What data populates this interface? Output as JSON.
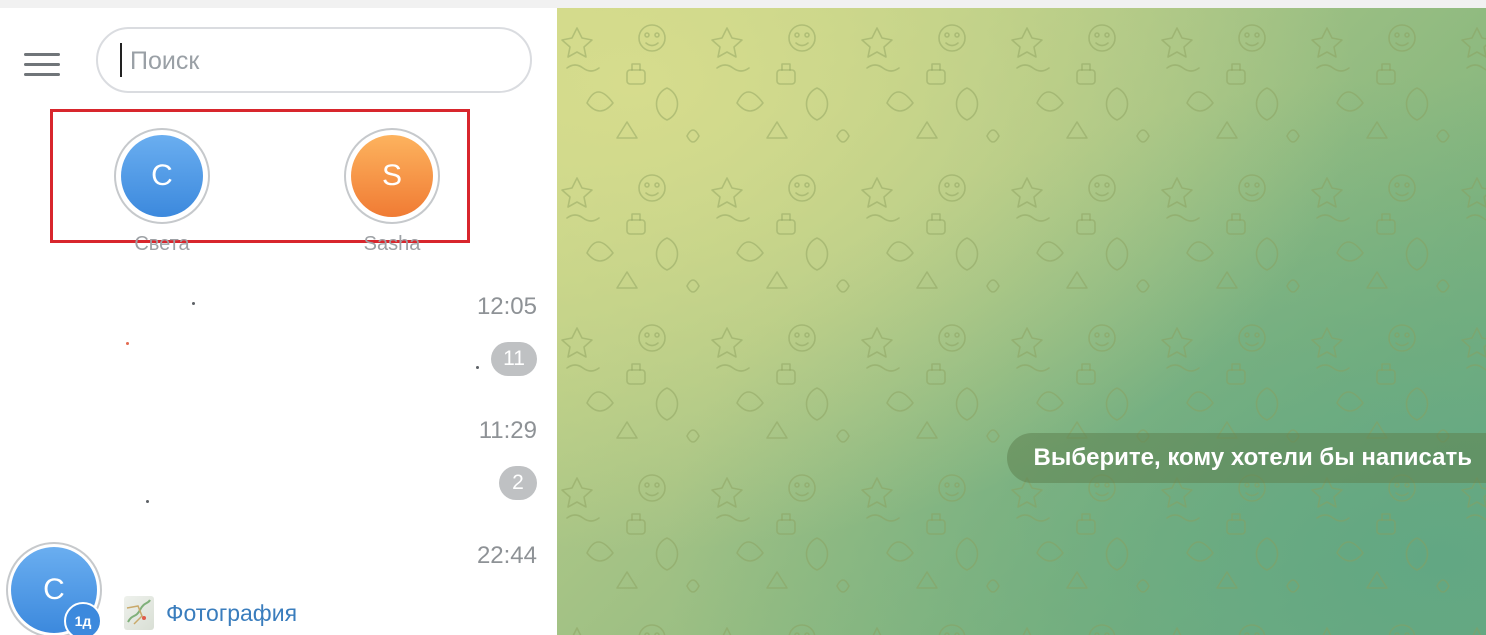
{
  "search": {
    "placeholder": "Поиск"
  },
  "stories": [
    {
      "initial": "С",
      "name": "Света"
    },
    {
      "initial": "S",
      "name": "Sasha"
    }
  ],
  "chats": [
    {
      "time": "12:05",
      "unread": "11"
    },
    {
      "time": "11:29",
      "unread": "2"
    },
    {
      "initial": "С",
      "timer": "1д",
      "time": "22:44",
      "preview": "Фотография"
    }
  ],
  "chat_area": {
    "empty_message": "Выберите, кому хотели бы написать"
  },
  "colors": {
    "avatar_blue": "#3c89dd",
    "avatar_orange": "#f07b34",
    "highlight_box": "#d8262d",
    "preview_link": "#3a7dbd",
    "badge_muted": "#bfc1c3"
  },
  "icons": [
    "hamburger-menu-icon",
    "timer-badge-icon",
    "photo-thumbnail-icon"
  ]
}
